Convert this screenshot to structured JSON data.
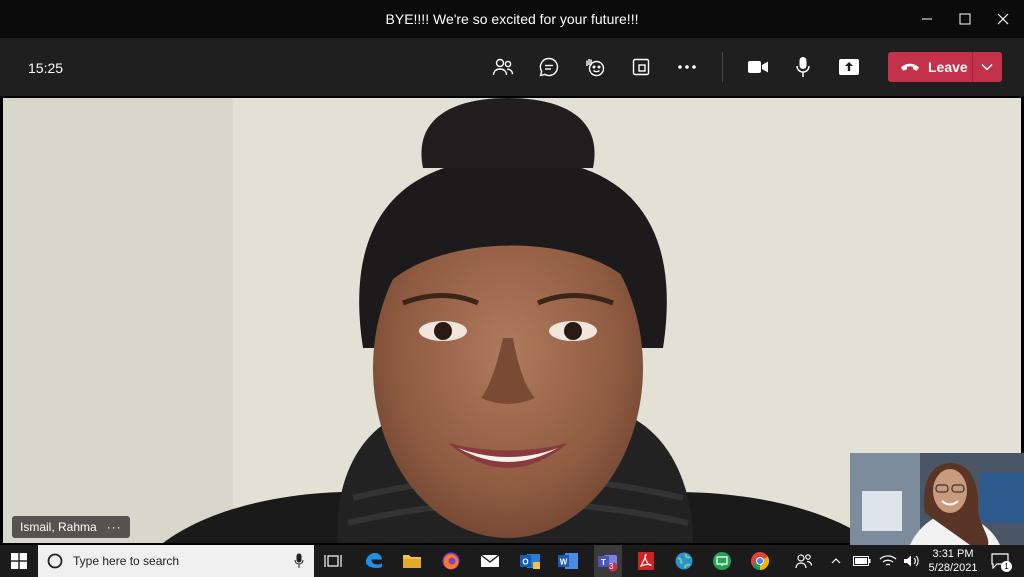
{
  "window": {
    "title": "BYE!!!! We're so excited for your future!!!"
  },
  "toolbar": {
    "duration": "15:25",
    "leave_label": "Leave"
  },
  "participant": {
    "name": "Ismail, Rahma",
    "more": "···"
  },
  "taskbar": {
    "search_placeholder": "Type here to search",
    "teams_badge": "3",
    "time": "3:31 PM",
    "date": "5/28/2021",
    "notification_count": "1"
  },
  "colors": {
    "leave": "#c4314b",
    "toolbar": "#1f1f1f",
    "titlebar": "#0b0b0b"
  }
}
